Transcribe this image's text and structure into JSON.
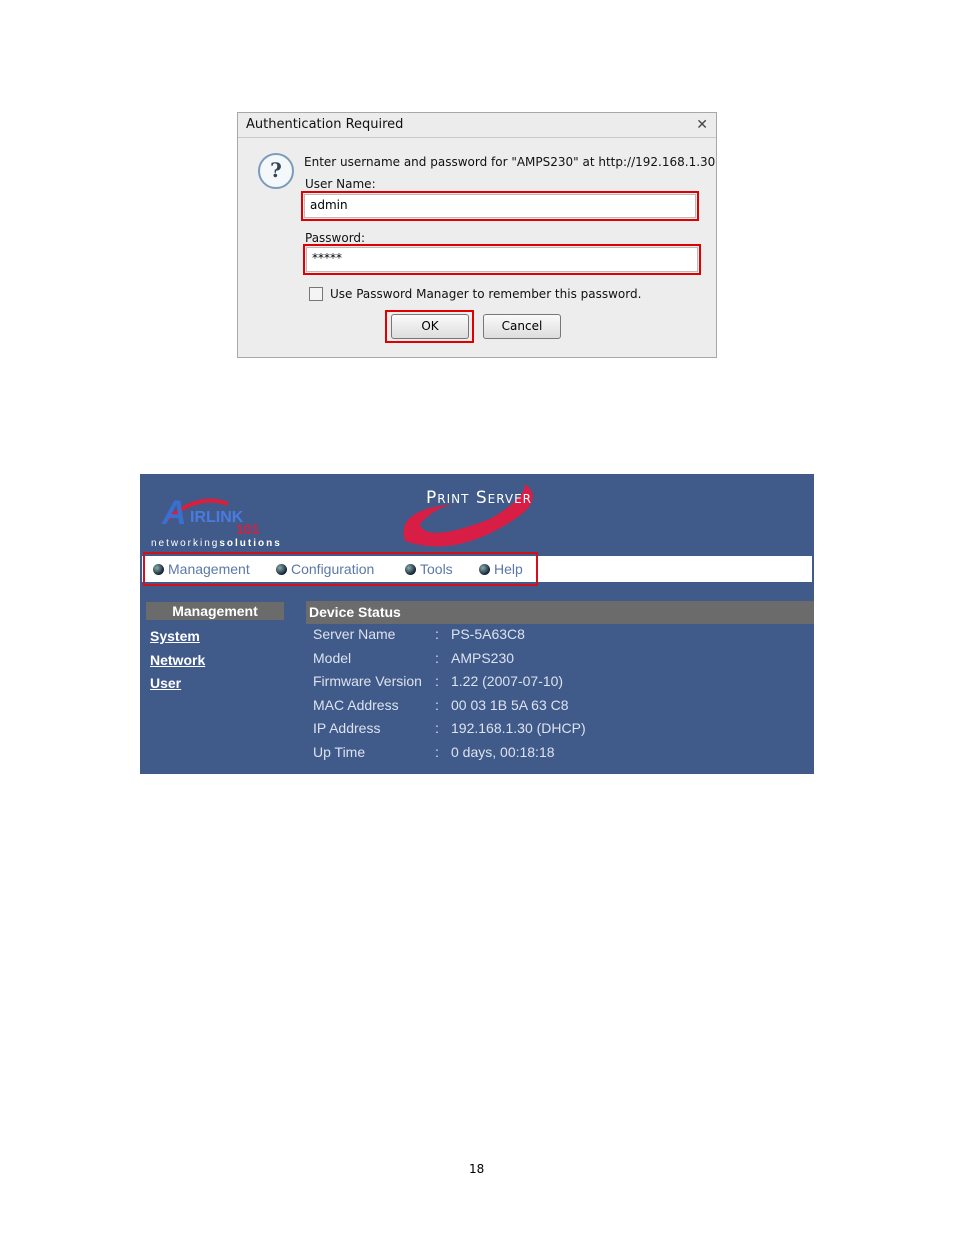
{
  "dialog": {
    "title": "Authentication Required",
    "close_icon": "close-icon",
    "prompt": "Enter username and password for \"AMPS230\" at http://192.168.1.30",
    "username_label": "User Name:",
    "username_value": "admin",
    "password_label": "Password:",
    "password_value": "*****",
    "remember_label": "Use Password Manager to remember this password.",
    "remember_checked": false,
    "ok_label": "OK",
    "cancel_label": "Cancel",
    "highlight_color": "#e00000"
  },
  "web": {
    "logo_text": "AIRLINK 101",
    "tagline_light": "networking",
    "tagline_bold": "solutions",
    "product_title": "Print Server",
    "bg_color": "#405a8a",
    "menu": [
      {
        "label": "Management"
      },
      {
        "label": "Configuration"
      },
      {
        "label": "Tools"
      },
      {
        "label": "Help"
      }
    ],
    "sidebar": {
      "heading": "Management",
      "links": [
        "System",
        "Network",
        "User"
      ]
    },
    "status": {
      "heading": "Device Status",
      "rows": [
        {
          "label": "Server Name",
          "value": "PS-5A63C8"
        },
        {
          "label": "Model",
          "value": "AMPS230"
        },
        {
          "label": "Firmware Version",
          "value": "1.22 (2007-07-10)"
        },
        {
          "label": "MAC Address",
          "value": "00 03 1B 5A 63 C8"
        },
        {
          "label": "IP Address",
          "value": "192.168.1.30 (DHCP)"
        },
        {
          "label": "Up Time",
          "value": "0 days, 00:18:18"
        }
      ]
    }
  },
  "page_number": "18"
}
